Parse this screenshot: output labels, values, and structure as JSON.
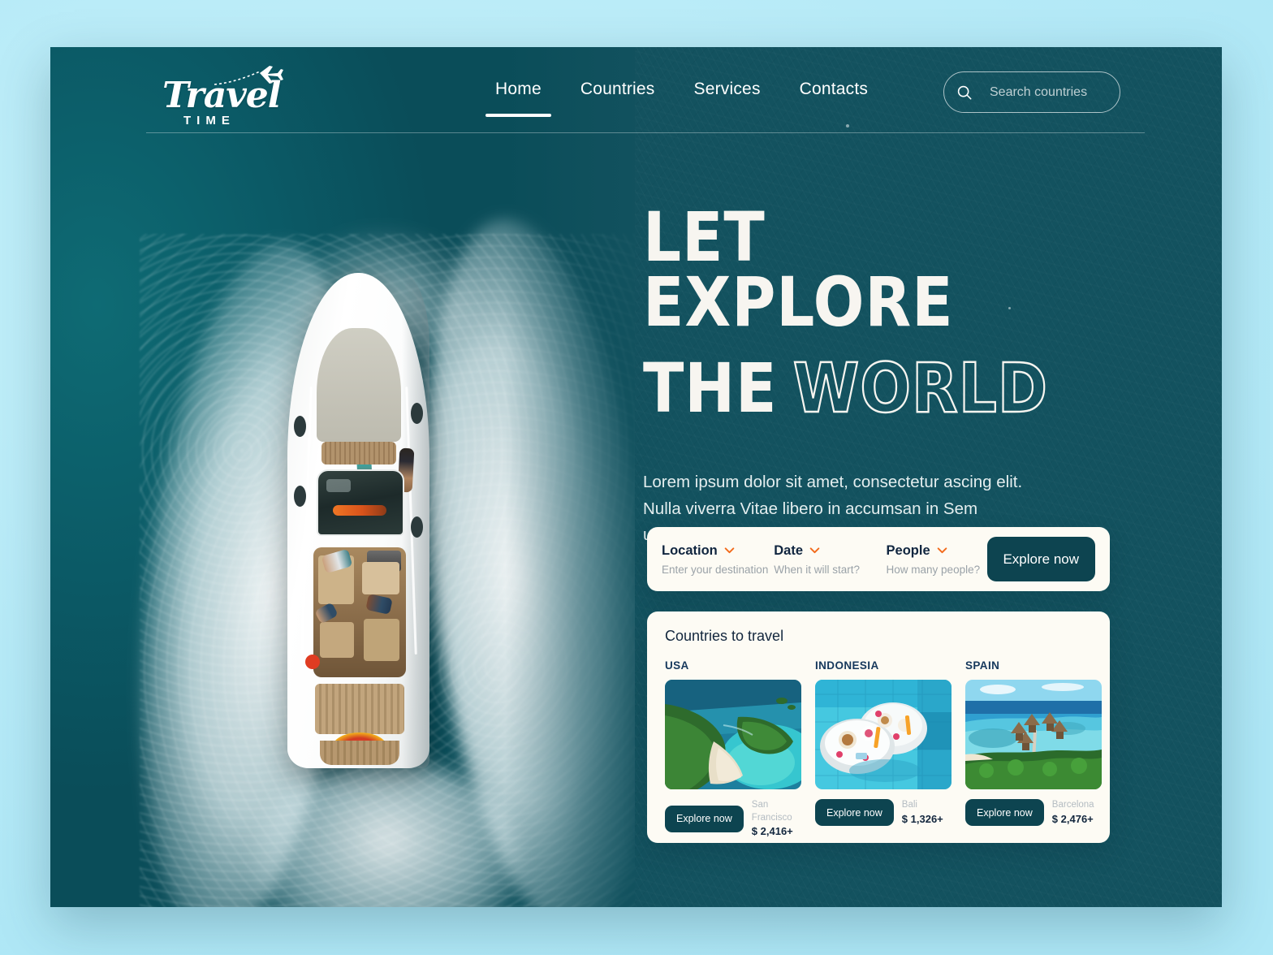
{
  "brand": {
    "script": "Travel",
    "sub": "TIME",
    "plane_icon": "airplane-icon"
  },
  "nav": {
    "items": [
      {
        "label": "Home",
        "active": true
      },
      {
        "label": "Countries",
        "active": false
      },
      {
        "label": "Services",
        "active": false
      },
      {
        "label": "Contacts",
        "active": false
      }
    ]
  },
  "search": {
    "icon": "search-icon",
    "placeholder": "Search countries",
    "value": ""
  },
  "hero": {
    "line1": "LET EXPLORE",
    "line2_solid": "THE",
    "line2_outline": "WORLD",
    "paragraph": "Lorem ipsum dolor sit amet, consectetur ascing elit. Nulla viverra Vitae libero in accumsan in Sem ultricies massa."
  },
  "booking": {
    "fields": [
      {
        "label": "Location",
        "sub": "Enter your destination",
        "icon": "chevron-down-icon"
      },
      {
        "label": "Date",
        "sub": "When it will start?",
        "icon": "chevron-down-icon"
      },
      {
        "label": "People",
        "sub": "How many people?",
        "icon": "chevron-down-icon"
      }
    ],
    "cta": "Explore now"
  },
  "countries": {
    "title": "Countries to travel",
    "cta": "Explore now",
    "items": [
      {
        "country": "USA",
        "city": "San Francisco",
        "price": "$ 2,416+",
        "image": "aerial-coastline-photo"
      },
      {
        "country": "INDONESIA",
        "city": "Bali",
        "price": "$ 1,326+",
        "image": "floating-breakfast-pool-photo"
      },
      {
        "country": "SPAIN",
        "city": "Barcelona",
        "price": "$ 2,476+",
        "image": "overwater-bungalows-photo"
      }
    ]
  },
  "colors": {
    "page_background": "#bfeef8",
    "hero_teal": "#13525f",
    "card_cream": "#fdfbf4",
    "button_dark_teal": "#0d4450",
    "accent_orange": "#f26a1b",
    "navy_text": "#12263d"
  }
}
